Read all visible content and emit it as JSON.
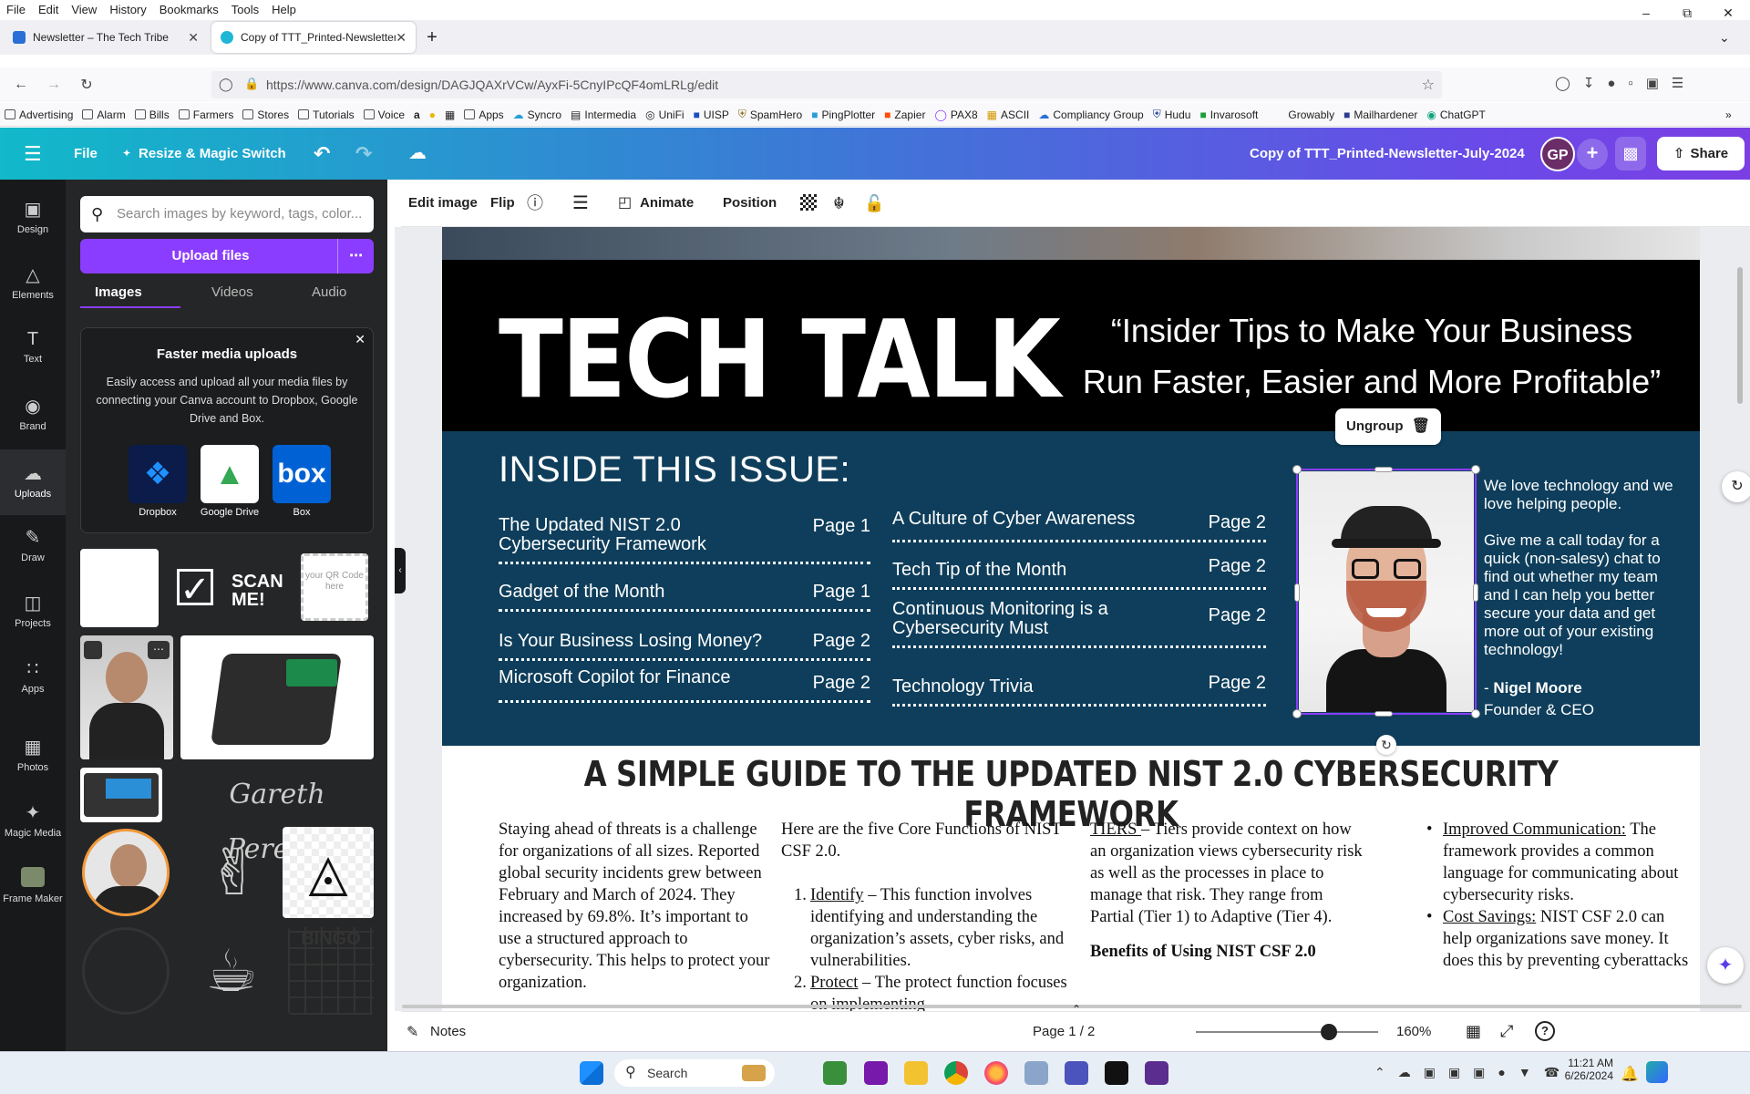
{
  "browser": {
    "menu": [
      "File",
      "Edit",
      "View",
      "History",
      "Bookmarks",
      "Tools",
      "Help"
    ],
    "tabs": [
      {
        "title": "Newsletter – The Tech Tribe"
      },
      {
        "title": "Copy of TTT_Printed-Newsletter-"
      }
    ],
    "url": "https://www.canva.com/design/DAGJQAXrVCw/AyxFi-5CnyIPcQF4omLRLg/edit",
    "bookmarks": [
      "Advertising",
      "Alarm",
      "Bills",
      "Farmers",
      "Stores",
      "Tutorials",
      "Voice",
      "Apps",
      "Syncro",
      "Intermedia",
      "UniFi",
      "UISP",
      "SpamHero",
      "PingPlotter",
      "Zapier",
      "PAX8",
      "ASCII",
      "Compliancy Group",
      "Hudu",
      "Invarosoft",
      "Growably",
      "Mailhardener",
      "ChatGPT"
    ]
  },
  "canva_header": {
    "menu_label": "File",
    "resize_label": "Resize & Magic Switch",
    "doc_title": "Copy of  TTT_Printed-Newsletter-July-2024",
    "avatar_initials": "GP",
    "share_label": "Share",
    "gradient_start": "#11b9c9",
    "gradient_end": "#7b3fe4"
  },
  "left_rail": [
    {
      "label": "Design",
      "icon": "design-icon"
    },
    {
      "label": "Elements",
      "icon": "elements-icon"
    },
    {
      "label": "Text",
      "icon": "text-icon"
    },
    {
      "label": "Brand",
      "icon": "brand-icon"
    },
    {
      "label": "Uploads",
      "icon": "uploads-icon"
    },
    {
      "label": "Draw",
      "icon": "draw-icon"
    },
    {
      "label": "Projects",
      "icon": "projects-icon"
    },
    {
      "label": "Apps",
      "icon": "apps-icon"
    },
    {
      "label": "Photos",
      "icon": "photos-icon"
    },
    {
      "label": "Magic Media",
      "icon": "magic-media-icon"
    },
    {
      "label": "Frame Maker",
      "icon": "frame-maker-icon"
    }
  ],
  "panel": {
    "search_placeholder": "Search images by keyword, tags, color...",
    "upload_label": "Upload files",
    "tabs": [
      "Images",
      "Videos",
      "Audio"
    ],
    "promo_title": "Faster media uploads",
    "promo_body": "Easily access and upload all your media files by connecting your Canva account to Dropbox, Google Drive and Box.",
    "services": [
      "Dropbox",
      "Google Drive",
      "Box"
    ],
    "thumb_scan_text": "SCAN ME!",
    "thumb_qr_text": "your QR Code here",
    "thumb_signature": "Gareth Pereira",
    "thumb_bingo": "BINGO"
  },
  "toolbar": {
    "items": [
      "Edit image",
      "Flip",
      "Animate",
      "Position"
    ]
  },
  "newsletter": {
    "title": "TECH TALK",
    "tagline": "“Insider Tips to Make Your Business Run Faster, Easier and More Profitable”",
    "inside_title": "INSIDE THIS ISSUE:",
    "toc_left": [
      {
        "title": "The Updated NIST 2.0 Cybersecurity Framework",
        "page": "Page 1"
      },
      {
        "title": "Gadget of the Month",
        "page": "Page 1"
      },
      {
        "title": "Is Your Business Losing Money?",
        "page": "Page 2"
      },
      {
        "title": "Microsoft Copilot for Finance",
        "page": "Page 2"
      }
    ],
    "toc_right": [
      {
        "title": "A Culture of Cyber Awareness",
        "page": "Page 2"
      },
      {
        "title": "Tech Tip of the Month",
        "page": "Page 2"
      },
      {
        "title": "Continuous Monitoring is a Cybersecurity Must",
        "page": "Page 2"
      },
      {
        "title": "Technology Trivia",
        "page": "Page 2"
      }
    ],
    "promo_line1": "We love technology and we love helping people.",
    "promo_line2": "Give me a call today for a quick (non-salesy) chat to find out whether my team and I can help you better secure your data and get more out of your existing technology!",
    "sign_dash": "- ",
    "sign_name": "Nigel Moore",
    "sign_role": "Founder & CEO",
    "ungroup_label": "Ungroup",
    "headline": "A SIMPLE GUIDE TO THE UPDATED NIST 2.0 CYBERSECURITY FRAMEWORK",
    "col1": "Staying ahead of threats is a challenge for organizations of all sizes. Reported global security incidents grew between February and March of 2024. They increased by 69.8%. It’s important to use a structured approach to cybersecurity. This helps to protect your organization.",
    "col2_intro": "Here are the five Core Functions of NIST CSF 2.0.",
    "col2_items": [
      {
        "num": "1.",
        "term": "Identify",
        "text": " – This function involves identifying and understanding the organization’s assets, cyber risks, and vulnerabilities."
      },
      {
        "num": "2.",
        "term": "Protect",
        "text": " – The protect function focuses on implementing"
      }
    ],
    "col3_term": "TIERS ",
    "col3_text": "– Tiers provide context on how an organization views cybersecurity risk as well as the processes in place to manage that risk. They range from Partial (Tier 1) to Adaptive (Tier 4).",
    "col3_heading": "Benefits of Using NIST CSF 2.0",
    "col4_items": [
      {
        "term": "Improved Communication:",
        "text": " The framework provides a common language for communicating about cybersecurity risks."
      },
      {
        "term": "Cost Savings:",
        "text": " NIST CSF 2.0 can help organizations save money. It does this by preventing cyberattacks"
      }
    ],
    "navy": "#0e3e5b"
  },
  "bottombar": {
    "notes_label": "Notes",
    "page_indicator": "Page 1 / 2",
    "zoom": "160%",
    "zoom_fraction": 0.73
  },
  "taskbar": {
    "search_label": "Search",
    "time": "11:21 AM",
    "date": "6/26/2024"
  }
}
